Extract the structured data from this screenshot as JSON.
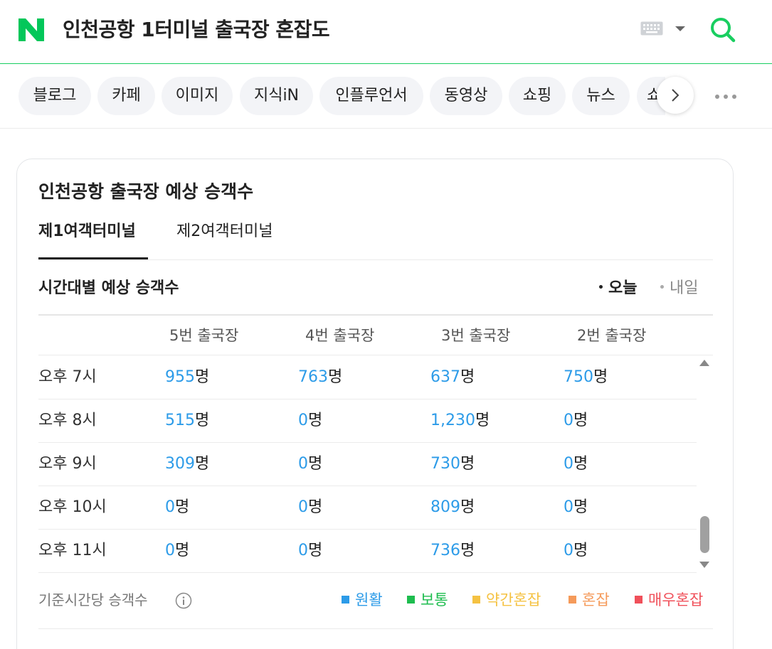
{
  "header": {
    "query": "인천공항 1터미널 출국장 혼잡도",
    "logo_letter": "N",
    "colors": {
      "brand": "#03c75a",
      "search": "#19ce60"
    }
  },
  "tabs": {
    "items": [
      {
        "label": "블로그"
      },
      {
        "label": "카페"
      },
      {
        "label": "이미지"
      },
      {
        "label": "지식iN"
      },
      {
        "label": "인플루언서"
      },
      {
        "label": "동영상"
      },
      {
        "label": "쇼핑"
      },
      {
        "label": "뉴스"
      }
    ],
    "clipped_label": "쇼",
    "next_icon": "chevron-right-icon",
    "more_icon": "more-horizontal-icon"
  },
  "card": {
    "title": "인천공항 출국장 예상 승객수",
    "terminals": [
      {
        "label": "제1여객터미널",
        "active": true
      },
      {
        "label": "제2여객터미널",
        "active": false
      }
    ],
    "section_title": "시간대별 예상 승객수",
    "day_options": [
      {
        "label": "오늘",
        "active": true
      },
      {
        "label": "내일",
        "active": false
      }
    ],
    "columns": [
      "5번 출국장",
      "4번 출국장",
      "3번 출국장",
      "2번 출국장"
    ],
    "unit": "명",
    "rows": [
      {
        "time": "오후 7시",
        "values": [
          "955",
          "763",
          "637",
          "750"
        ]
      },
      {
        "time": "오후 8시",
        "values": [
          "515",
          "0",
          "1,230",
          "0"
        ]
      },
      {
        "time": "오후 9시",
        "values": [
          "309",
          "0",
          "730",
          "0"
        ]
      },
      {
        "time": "오후 10시",
        "values": [
          "0",
          "0",
          "809",
          "0"
        ]
      },
      {
        "time": "오후 11시",
        "values": [
          "0",
          "0",
          "736",
          "0"
        ]
      }
    ],
    "basis_label": "기준시간당 승객수",
    "legend": [
      {
        "label": "원활",
        "color": "#2c9be8"
      },
      {
        "label": "보통",
        "color": "#1ebd4f"
      },
      {
        "label": "약간혼잡",
        "color": "#f5c242"
      },
      {
        "label": "혼잡",
        "color": "#f59a5a"
      },
      {
        "label": "매우혼잡",
        "color": "#f0505a"
      }
    ],
    "value_color": "#2c9be8"
  }
}
